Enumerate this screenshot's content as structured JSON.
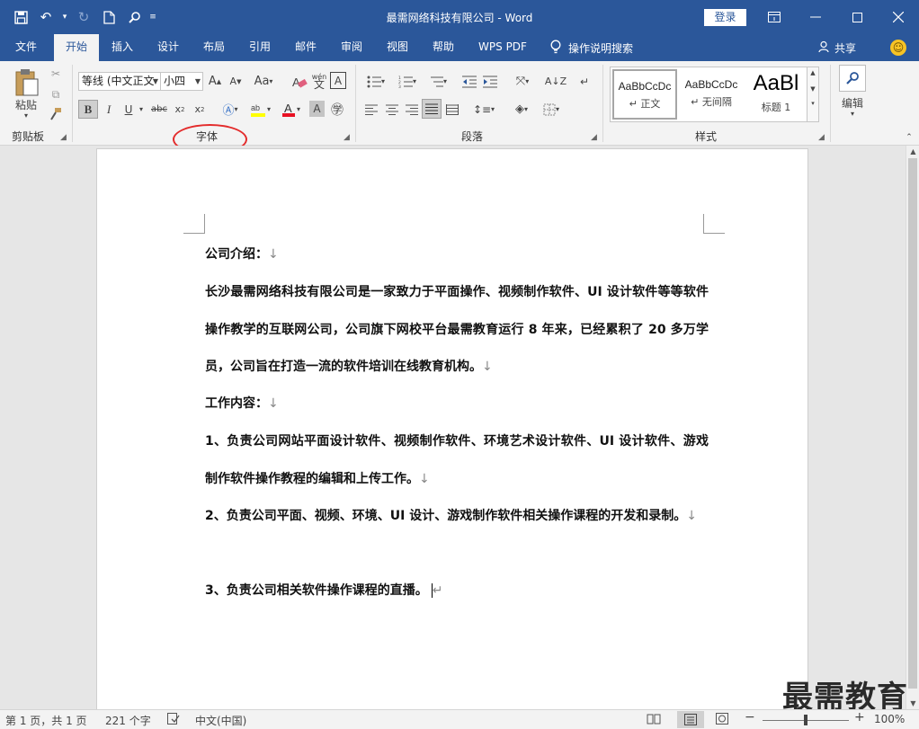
{
  "titlebar": {
    "title": "最需网络科技有限公司 - Word",
    "login": "登录"
  },
  "tabs": [
    {
      "label": "文件"
    },
    {
      "label": "开始"
    },
    {
      "label": "插入"
    },
    {
      "label": "设计"
    },
    {
      "label": "布局"
    },
    {
      "label": "引用"
    },
    {
      "label": "邮件"
    },
    {
      "label": "审阅"
    },
    {
      "label": "视图"
    },
    {
      "label": "帮助"
    },
    {
      "label": "WPS PDF"
    }
  ],
  "tell_me": "操作说明搜索",
  "share": "共享",
  "ribbon": {
    "clipboard": {
      "label": "剪贴板",
      "paste": "粘贴"
    },
    "font": {
      "label": "字体",
      "font_name": "等线 (中文正文",
      "font_size": "小四",
      "case": "Aa",
      "phonetic": "wén"
    },
    "paragraph": {
      "label": "段落"
    },
    "styles": {
      "label": "样式",
      "items": [
        {
          "preview": "AaBbCcDc",
          "name": "↵ 正文"
        },
        {
          "preview": "AaBbCcDc",
          "name": "↵ 无间隔"
        },
        {
          "preview": "AaBl",
          "name": "标题 1"
        }
      ]
    },
    "editing": {
      "label": "编辑"
    }
  },
  "document": {
    "paragraphs": [
      "公司介绍：",
      "长沙最需网络科技有限公司是一家致力于平面操作、视频制作软件、UI 设计软件等等软件操作教学的互联网公司，公司旗下网校平台最需教育运行 8 年来，已经累积了 20 多万学员，公司旨在打造一流的软件培训在线教育机构。",
      "工作内容：",
      "1、负责公司网站平面设计软件、视频制作软件、环境艺术设计软件、UI 设计软件、游戏制作软件操作教程的编辑和上传工作。",
      "2、负责公司平面、视频、环境、UI 设计、游戏制作软件相关操作课程的开发和录制。",
      "3、负责公司相关软件操作课程的直播。"
    ],
    "para_mark": "↓",
    "end_mark": "↵"
  },
  "watermark": "最需教育",
  "statusbar": {
    "page": "第 1 页，共 1 页",
    "words": "221 个字",
    "language": "中文(中国)",
    "zoom": "100%",
    "zoom_level_percent": 100
  }
}
